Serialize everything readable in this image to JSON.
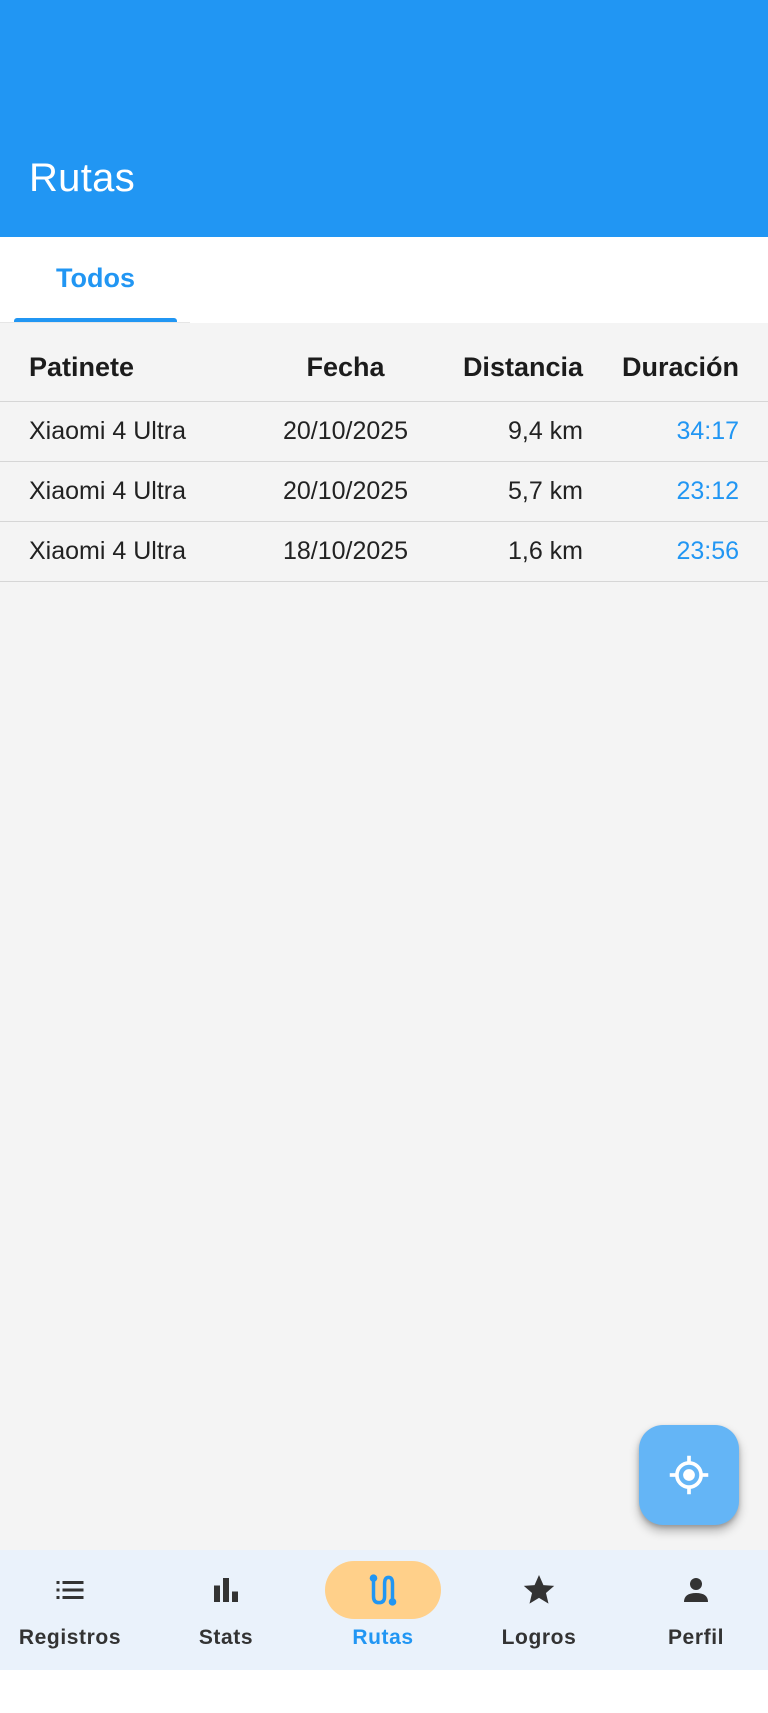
{
  "app_bar": {
    "title": "Rutas",
    "color": "#2196f3"
  },
  "tabs": [
    {
      "label": "Todos",
      "selected": true
    }
  ],
  "table": {
    "headers": {
      "scooter": "Patinete",
      "date": "Fecha",
      "distance": "Distancia",
      "duration": "Duración"
    },
    "rows": [
      {
        "scooter": "Xiaomi 4 Ultra",
        "date": "20/10/2025",
        "distance": "9,4 km",
        "duration": "34:17"
      },
      {
        "scooter": "Xiaomi 4 Ultra",
        "date": "20/10/2025",
        "distance": "5,7 km",
        "duration": "23:12"
      },
      {
        "scooter": "Xiaomi 4 Ultra",
        "date": "18/10/2025",
        "distance": "1,6 km",
        "duration": "23:56"
      }
    ]
  },
  "fab": {
    "icon": "my-location-icon"
  },
  "bottom_nav": {
    "items": [
      {
        "label": "Registros",
        "icon": "list-icon",
        "active": false
      },
      {
        "label": "Stats",
        "icon": "bar-chart-icon",
        "active": false
      },
      {
        "label": "Rutas",
        "icon": "route-icon",
        "active": true
      },
      {
        "label": "Logros",
        "icon": "star-icon",
        "active": false
      },
      {
        "label": "Perfil",
        "icon": "person-icon",
        "active": false
      }
    ]
  },
  "colors": {
    "accent": "#2196f3",
    "active_pill": "#ffd08a",
    "fab": "#64b5f6",
    "background": "#f4f4f4"
  }
}
